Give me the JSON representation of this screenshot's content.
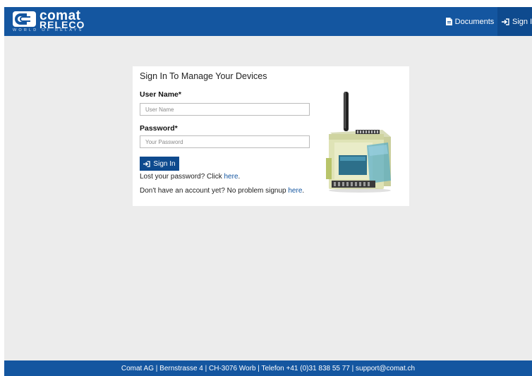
{
  "header": {
    "logo_text_1": "comat",
    "logo_text_2": "RELECO",
    "logo_tagline": "WORLD OF RELAYS",
    "nav": {
      "documents_label": "Documents",
      "documents_icon": "document-icon",
      "signin_label": "Sign In",
      "signin_icon": "sign-in-icon"
    }
  },
  "login": {
    "title": "Sign In To Manage Your Devices",
    "username_label": "User Name*",
    "username_placeholder": "User Name",
    "username_value": "",
    "password_label": "Password*",
    "password_placeholder": "Your Password",
    "password_value": "",
    "signin_button": "Sign In",
    "lost_password_prefix": "Lost your password? Click ",
    "lost_password_link": "here",
    "lost_password_suffix": ".",
    "signup_prefix": "Don't have an account yet? No problem signup ",
    "signup_link": "here",
    "signup_suffix": "."
  },
  "footer": {
    "text": "Comat AG  |  Bernstrasse 4  |  CH-3076 Worb | Telefon +41 (0)31 838 55 77 | support@comat.ch"
  },
  "colors": {
    "brand_blue": "#1456a0",
    "active_nav": "#0e4a8e",
    "page_bg": "#ececec",
    "link": "#1456a0"
  }
}
